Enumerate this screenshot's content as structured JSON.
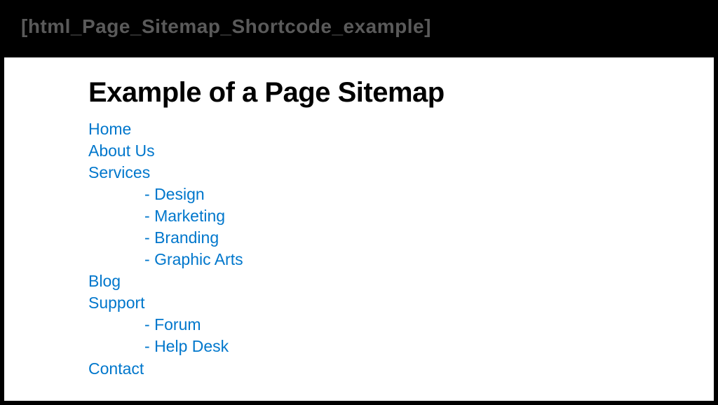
{
  "header": {
    "shortcode": "[html_Page_Sitemap_Shortcode_example]"
  },
  "main": {
    "title": "Example of a Page Sitemap",
    "sitemap": {
      "home": "Home",
      "about": "About Us",
      "services": "Services",
      "services_children": {
        "design": "Design",
        "marketing": " Marketing",
        "branding": "Branding",
        "graphic_arts": "Graphic Arts"
      },
      "blog": "Blog",
      "support": "Support",
      "support_children": {
        "forum": "Forum",
        "help_desk": "Help Desk"
      },
      "contact": "Contact"
    }
  }
}
